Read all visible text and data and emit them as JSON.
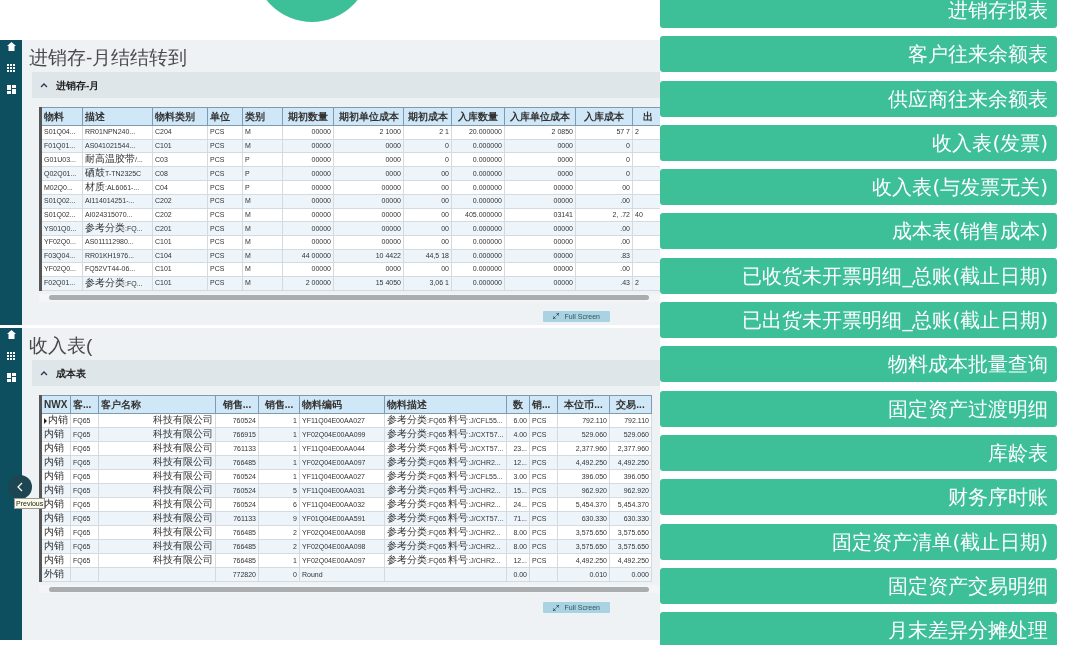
{
  "top_panel": {
    "title": "进销存-月结结转到",
    "section": {
      "title": "进销存-月",
      "expanded": true
    },
    "table": {
      "columns": [
        "物料",
        "描述",
        "物料类别",
        "单位",
        "类别",
        "期初数量",
        "期初单位成本",
        "期初成本",
        "入库数量",
        "入库单位成本",
        "入库成本",
        "出"
      ],
      "rows": [
        [
          "S01Q04...",
          "RR01NPN240...",
          "C204",
          "PCS",
          "M",
          "00000",
          "2 1000",
          "2 1",
          "20.000000",
          "2 0850",
          "57 7",
          "2"
        ],
        [
          "F01Q01...",
          "AS041021544...",
          "C101",
          "PCS",
          "M",
          "00000",
          "0000",
          "0",
          "0.000000",
          "0000",
          "0",
          null
        ],
        [
          "G01U03...",
          "耐高温胶带/...",
          "C03",
          "PCS",
          "P",
          "00000",
          "0000",
          "0",
          "0.000000",
          "0000",
          "0",
          null
        ],
        [
          "Q02Q01...",
          "硒鼓T-TN2325C",
          "C08",
          "PCS",
          "P",
          "00000",
          "0000",
          "00",
          "0.000000",
          "0000",
          "0",
          null
        ],
        [
          "M02Q0...",
          "材质:AL6061-...",
          "C04",
          "PCS",
          "P",
          "00000",
          "00000",
          "00",
          "0.000000",
          "00000",
          "00",
          null
        ],
        [
          "S01Q02...",
          "AI114014251-...",
          "C202",
          "PCS",
          "M",
          "00000",
          "00000",
          "00",
          "0.000000",
          "00000",
          ".00",
          null
        ],
        [
          "S01Q02...",
          "AI024315070...",
          "C202",
          "PCS",
          "M",
          "00000",
          "00000",
          "00",
          "405.000000",
          "03141",
          "2, .72",
          "40"
        ],
        [
          "YS01Q0...",
          "参考分类:FQ...",
          "C201",
          "PCS",
          "M",
          "00000",
          "00000",
          "00",
          "0.000000",
          "00000",
          ".00",
          null
        ],
        [
          "YF02Q0...",
          "AS011112980...",
          "C101",
          "PCS",
          "M",
          "00000",
          "00000",
          "00",
          "0.000000",
          "00000",
          ".00",
          null
        ],
        [
          "F03Q04...",
          "RR01KH1976...",
          "C104",
          "PCS",
          "M",
          "44 00000",
          "10 4422",
          "44,5 18",
          "0.000000",
          "00000",
          ".83",
          null
        ],
        [
          "YF02Q0...",
          "FQ52VT44-06...",
          "C101",
          "PCS",
          "M",
          "00000",
          "0000",
          "00",
          "0.000000",
          "00000",
          ".00",
          null
        ],
        [
          "F02Q01...",
          "参考分类:FQ...",
          "C101",
          "PCS",
          "M",
          "2 00000",
          "15 4050",
          "3,06 1",
          "0.000000",
          "00000",
          ".43",
          "2"
        ]
      ]
    },
    "full_screen": "Full Screen"
  },
  "bottom_panel": {
    "title": "收入表(",
    "section": {
      "title": "成本表",
      "expanded": true
    },
    "table": {
      "columns": [
        "NWX",
        "客...",
        "客户名称",
        "销售...",
        "销售...",
        "物料编码",
        "物料描述",
        "数",
        "销...",
        "本位币...",
        "交易..."
      ],
      "rows": [
        {
          "selected": true,
          "cells": [
            "内销",
            "FQ65",
            "科技有限公司",
            "760524",
            "1",
            "YF11Q04E00AA027",
            "参考分类:FQ65 料号:J/CFL55...",
            "6.00",
            "PCS",
            "792.110",
            "792.110"
          ]
        },
        {
          "selected": false,
          "cells": [
            "内销",
            "FQ65",
            "科技有限公司",
            "766915",
            "1",
            "YF02Q04E00AA099",
            "参考分类:FQ65 料号:J/CXT57...",
            "4.00",
            "PCS",
            "529.060",
            "529.060"
          ]
        },
        {
          "selected": false,
          "cells": [
            "内销",
            "FQ65",
            "科技有限公司",
            "761133",
            "1",
            "YF11Q04E00AA044",
            "参考分类:FQ65 料号:J/CXT57...",
            "23...",
            "PCS",
            "2,377.960",
            "2,377.960"
          ]
        },
        {
          "selected": false,
          "cells": [
            "内销",
            "FQ65",
            "科技有限公司",
            "766485",
            "1",
            "YF02Q04E00AA097",
            "参考分类:FQ65 料号:J/CHR2...",
            "12...",
            "PCS",
            "4,492.250",
            "4,492.250"
          ]
        },
        {
          "selected": false,
          "cells": [
            "内销",
            "FQ65",
            "科技有限公司",
            "760524",
            "1",
            "YF11Q04E00AA027",
            "参考分类:FQ65 料号:J/CFL55...",
            "3.00",
            "PCS",
            "396.050",
            "396.050"
          ]
        },
        {
          "selected": false,
          "cells": [
            "内销",
            "FQ65",
            "科技有限公司",
            "760524",
            "5",
            "YF11Q04E00AA031",
            "参考分类:FQ65 料号:J/CHR2...",
            "15...",
            "PCS",
            "962.920",
            "962.920"
          ]
        },
        {
          "selected": false,
          "cells": [
            "内销",
            "FQ65",
            "科技有限公司",
            "760524",
            "6",
            "YF11Q04E00AA032",
            "参考分类:FQ65 料号:J/CHR2...",
            "24...",
            "PCS",
            "5,454.370",
            "5,454.370"
          ]
        },
        {
          "selected": false,
          "cells": [
            "内销",
            "FQ65",
            "科技有限公司",
            "761133",
            "9",
            "YF01Q04E00AA591",
            "参考分类:FQ65 料号:J/CXT57...",
            "71...",
            "PCS",
            "630.330",
            "630.330"
          ]
        },
        {
          "selected": false,
          "cells": [
            "内销",
            "FQ65",
            "科技有限公司",
            "766485",
            "2",
            "YF02Q04E00AA098",
            "参考分类:FQ65 料号:J/CHR2...",
            "8.00",
            "PCS",
            "3,575.650",
            "3,575.650"
          ]
        },
        {
          "selected": false,
          "cells": [
            "内销",
            "FQ65",
            "科技有限公司",
            "766485",
            "2",
            "YF02Q04E00AA098",
            "参考分类:FQ65 料号:J/CHR2...",
            "8.00",
            "PCS",
            "3,575.650",
            "3,575.650"
          ]
        },
        {
          "selected": false,
          "cells": [
            "内销",
            "FQ65",
            "科技有限公司",
            "766485",
            "1",
            "YF02Q04E00AA097",
            "参考分类:FQ65 料号:J/CHR2...",
            "12...",
            "PCS",
            "4,492.250",
            "4,492.250"
          ]
        },
        {
          "selected": false,
          "cells": [
            "外销",
            null,
            null,
            "772820",
            "0",
            "Round",
            null,
            "0.00",
            null,
            "0.010",
            "0.000"
          ]
        }
      ]
    },
    "full_screen": "Full Screen"
  },
  "previous": {
    "tooltip": "Previous"
  },
  "nav_buttons": [
    "进销存报表",
    "客户往来余额表",
    "供应商往来余额表",
    "收入表(发票)",
    "收入表(与发票无关)",
    "成本表(销售成本)",
    "已收货未开票明细_总账(截止日期)",
    "已出货未开票明细_总账(截止日期)",
    "物料成本批量查询",
    "固定资产过渡明细",
    "库龄表",
    "财务序时账",
    "固定资产清单(截止日期)",
    "固定资产交易明细",
    "月末差异分摊处理"
  ]
}
